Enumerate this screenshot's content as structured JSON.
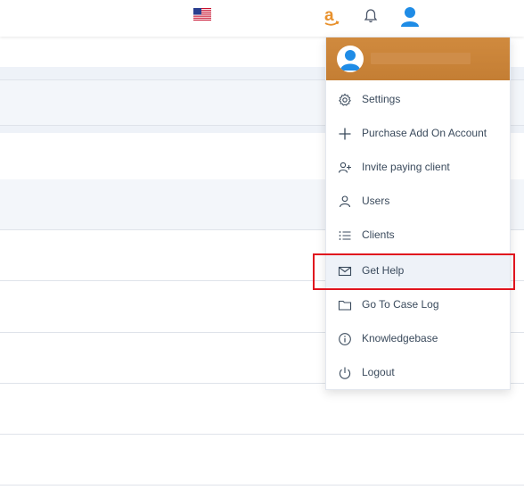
{
  "header": {
    "locale_icon": "us-flag-icon",
    "amazon_icon": "amazon-logo-icon",
    "notifications_icon": "bell-icon",
    "account_icon": "user-avatar-icon"
  },
  "user_menu": {
    "avatar_icon": "user-avatar-icon",
    "header_color": "#c98438",
    "items": [
      {
        "label": "Settings",
        "icon": "gear-icon"
      },
      {
        "label": "Purchase Add On Account",
        "icon": "plus-icon"
      },
      {
        "label": "Invite paying client",
        "icon": "user-plus-icon"
      },
      {
        "label": "Users",
        "icon": "user-icon"
      },
      {
        "label": "Clients",
        "icon": "list-icon"
      },
      {
        "label": "Get Help",
        "icon": "mail-icon"
      },
      {
        "label": "Go To Case Log",
        "icon": "folder-icon"
      },
      {
        "label": "Knowledgebase",
        "icon": "info-icon"
      },
      {
        "label": "Logout",
        "icon": "power-icon"
      }
    ],
    "highlighted_item": "Get Help",
    "highlight_color": "#e0141e"
  }
}
